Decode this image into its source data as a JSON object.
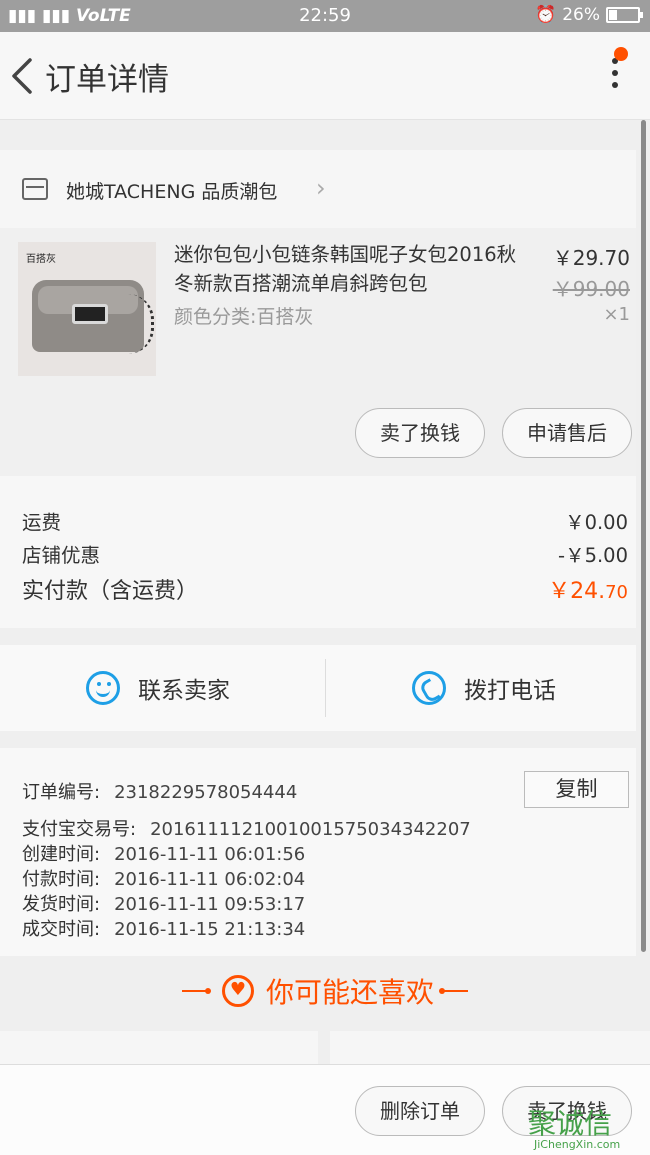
{
  "status_bar": {
    "network": "VoLTE",
    "time": "22:59",
    "battery": "26%",
    "battery_level": 0.26
  },
  "nav": {
    "title": "订单详情"
  },
  "shop": {
    "name": "她城TACHENG 品质潮包"
  },
  "item": {
    "image_label": "百搭灰",
    "title": "迷你包包小包链条韩国呢子女包2016秋冬新款百搭潮流单肩斜跨包包",
    "sku": "颜色分类:百搭灰",
    "price": "￥29.70",
    "original_price": "￥99.00",
    "quantity": "×1",
    "buttons": [
      "卖了换钱",
      "申请售后"
    ]
  },
  "fees": {
    "shipping_label": "运费",
    "shipping_value": "￥0.00",
    "discount_label": "店铺优惠",
    "discount_value": "-￥5.00",
    "total_label": "实付款（含运费）",
    "total_value_main": "￥24.",
    "total_value_cents": "70"
  },
  "contact": {
    "seller": "联系卖家",
    "call": "拨打电话"
  },
  "order_info": {
    "copy_label": "复制",
    "rows": [
      {
        "label": "订单编号:",
        "value": "2318229578054444"
      },
      {
        "label": "支付宝交易号:",
        "value": "2016111121001001575034342207"
      },
      {
        "label": "创建时间:",
        "value": "2016-11-11 06:01:56"
      },
      {
        "label": "付款时间:",
        "value": "2016-11-11 06:02:04"
      },
      {
        "label": "发货时间:",
        "value": "2016-11-11 09:53:17"
      },
      {
        "label": "成交时间:",
        "value": "2016-11-15 21:13:34"
      }
    ]
  },
  "recommend": {
    "title": "你可能还喜欢"
  },
  "bottom_bar": {
    "delete": "删除订单",
    "resell": "卖了换钱"
  },
  "watermark": {
    "main": "聚诚信",
    "sub": "JiChengXin.com"
  },
  "colors": {
    "accent": "#ff5000",
    "link_blue": "#1e9fe6"
  }
}
